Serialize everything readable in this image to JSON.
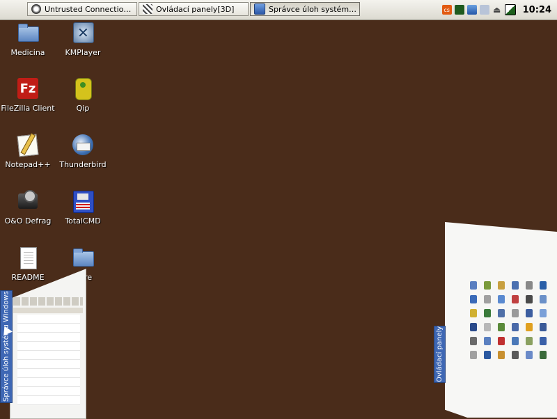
{
  "taskbar": {
    "windows": [
      {
        "label": "Untrusted Connectio…",
        "icon": "firefox-icon"
      },
      {
        "label": "Ovládací panely[3D]",
        "icon": "control-panel-icon"
      },
      {
        "label": "Správce úloh systém…",
        "icon": "task-manager-icon"
      }
    ],
    "tray": {
      "clock": "10:24",
      "icons": [
        "cs-icon",
        "green-square-icon",
        "network-icon",
        "user-icon",
        "eject-icon",
        "battery-icon"
      ]
    }
  },
  "desktop": {
    "icons": [
      {
        "label": "Medicina",
        "icon": "folder-icon"
      },
      {
        "label": "KMPlayer",
        "icon": "kmplayer-icon"
      },
      {
        "label": "FileZilla Client",
        "icon": "filezilla-icon"
      },
      {
        "label": "Qip",
        "icon": "qip-icon"
      },
      {
        "label": "Notepad++",
        "icon": "notepadpp-icon"
      },
      {
        "label": "Thunderbird",
        "icon": "thunderbird-icon"
      },
      {
        "label": "O&O Defrag",
        "icon": "oodefrag-icon"
      },
      {
        "label": "TotalCMD",
        "icon": "totalcmd-icon"
      },
      {
        "label": "README",
        "icon": "document-icon"
      },
      {
        "label": "Dare",
        "icon": "folder-icon"
      }
    ]
  },
  "windows3d": {
    "left_tab": "Správce úloh systému Windows",
    "right_tab": "Ovládací panely"
  },
  "colors": {
    "desktop_background": "#4a2c1a",
    "tab_blue": "#3e67b4"
  }
}
